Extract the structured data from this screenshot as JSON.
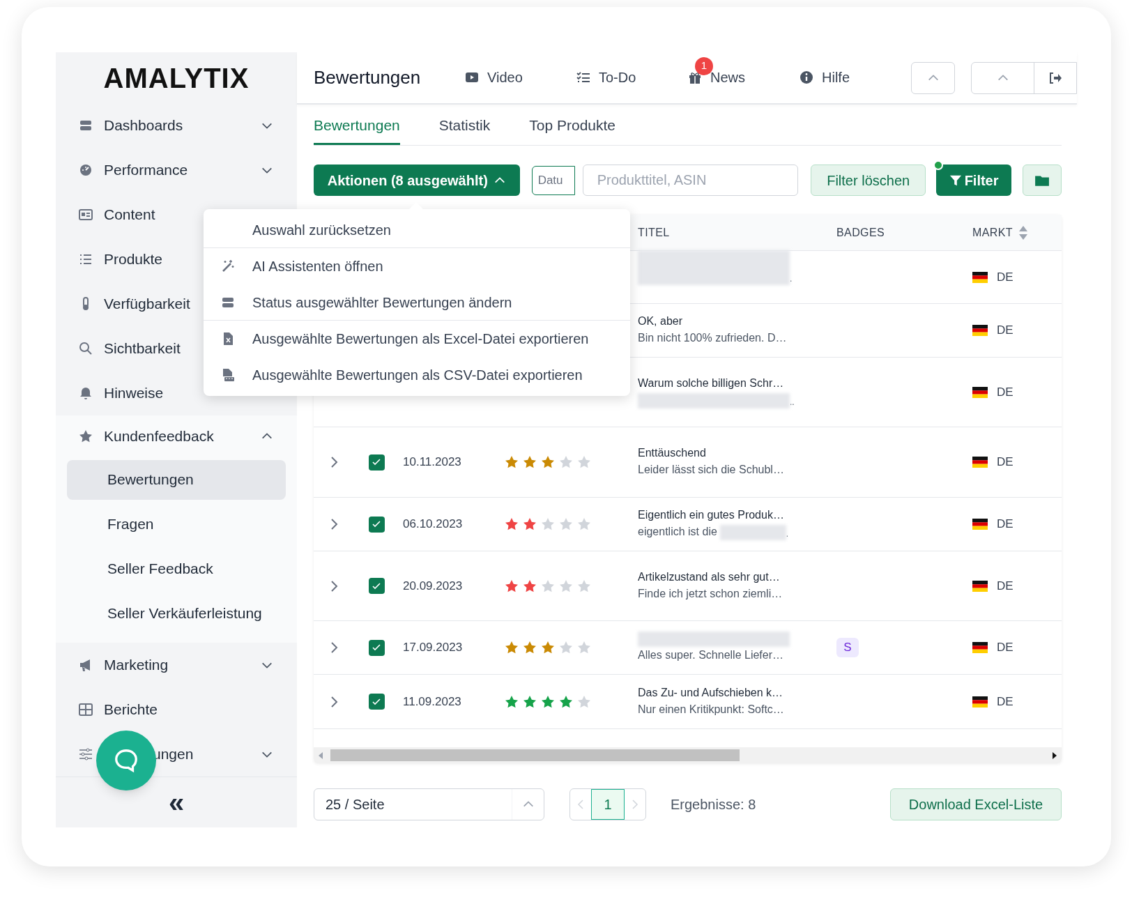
{
  "sidebar": {
    "logo": "AMALYTIX",
    "items": [
      {
        "label": "Dashboards",
        "expanded": false
      },
      {
        "label": "Performance",
        "expanded": false
      },
      {
        "label": "Content"
      },
      {
        "label": "Produkte"
      },
      {
        "label": "Verfügbarkeit"
      },
      {
        "label": "Sichtbarkeit"
      },
      {
        "label": "Hinweise"
      },
      {
        "label": "Kundenfeedback",
        "expanded": true,
        "children": [
          {
            "label": "Bewertungen",
            "selected": true
          },
          {
            "label": "Fragen",
            "selected": false
          },
          {
            "label": "Seller Feedback",
            "selected": false
          },
          {
            "label": "Seller Verkäuferleistung",
            "selected": false
          }
        ]
      },
      {
        "label": "Marketing",
        "expanded": false
      },
      {
        "label": "Berichte"
      },
      {
        "label": "ungen",
        "expanded": false
      }
    ],
    "collapse": "«"
  },
  "header": {
    "title": "Bewertungen",
    "links": [
      {
        "label": "Video"
      },
      {
        "label": "To-Do"
      },
      {
        "label": "News",
        "badge": "1"
      },
      {
        "label": "Hilfe"
      }
    ]
  },
  "tabs": [
    {
      "label": "Bewertungen",
      "selected": true
    },
    {
      "label": "Statistik",
      "selected": false
    },
    {
      "label": "Top Produkte",
      "selected": false
    }
  ],
  "toolbar": {
    "actions": "Aktionen (8 ausgewählt)",
    "date_placeholder": "Datu",
    "search_placeholder": "Produkttitel, ASIN",
    "clear": "Filter löschen",
    "filter": "Filter",
    "filter_active": true
  },
  "menu": [
    {
      "label": "Auswahl zurücksetzen",
      "divider_after": true
    },
    {
      "label": "AI Assistenten öffnen",
      "divider_after": false
    },
    {
      "label": "Status ausgewählter Bewertungen ändern",
      "divider_after": true
    },
    {
      "label": "Ausgewählte Bewertungen als Excel-Datei exportieren",
      "divider_after": false
    },
    {
      "label": "Ausgewählte Bewertungen als CSV-Datei exportieren",
      "divider_after": false
    }
  ],
  "table": {
    "columns": [
      "TITEL",
      "BADGES",
      "MARKT"
    ],
    "rows": [
      {
        "lines": [
          {
            "blur": true,
            "after": "."
          }
        ],
        "market": "DE"
      },
      {
        "lines": [
          {
            "text": "OK, aber",
            "strong": true
          },
          {
            "text": "Bin nicht 100% zufrieden. D…"
          }
        ],
        "market": "DE"
      },
      {
        "lines": [
          {
            "text": "Warum solche billigen Schr…",
            "strong": true
          },
          {
            "blur": true,
            "after": ".."
          }
        ],
        "market": "DE"
      },
      {
        "checked": true,
        "date": "10.11.2023",
        "stars": 3,
        "color": "#ca8a04",
        "lines": [
          {
            "text": "Enttäuschend",
            "strong": true
          },
          {
            "text": "Leider lässt sich die Schubl…"
          }
        ],
        "market": "DE"
      },
      {
        "checked": true,
        "date": "06.10.2023",
        "stars": 2,
        "color": "#ef4444",
        "lines": [
          {
            "text": "Eigentlich ein gutes Produk…",
            "strong": true
          },
          {
            "text": "eigentlich ist die",
            "blur": true,
            "after": "."
          }
        ],
        "market": "DE"
      },
      {
        "checked": true,
        "date": "20.09.2023",
        "stars": 2,
        "color": "#ef4444",
        "lines": [
          {
            "text": "Artikelzustand als sehr gut…",
            "strong": true
          },
          {
            "text": "Finde ich jetzt schon ziemli…"
          }
        ],
        "market": "DE"
      },
      {
        "checked": true,
        "date": "17.09.2023",
        "stars": 3,
        "color": "#ca8a04",
        "lines": [
          {
            "blur": true
          },
          {
            "text": "Alles super. Schnelle Liefer…"
          }
        ],
        "badge": "S",
        "market": "DE"
      },
      {
        "checked": true,
        "date": "11.09.2023",
        "stars": 4,
        "color": "#16a34a",
        "lines": [
          {
            "text": "Das Zu- und Aufschieben k…",
            "strong": true
          },
          {
            "text": "Nur einen Kritikpunkt: Softc…"
          }
        ],
        "market": "DE"
      }
    ]
  },
  "footer": {
    "page_size": "25 / Seite",
    "pages": [
      {
        "label": "1",
        "selected": true
      }
    ],
    "results": "Ergebnisse: 8",
    "download": "Download Excel-Liste"
  }
}
